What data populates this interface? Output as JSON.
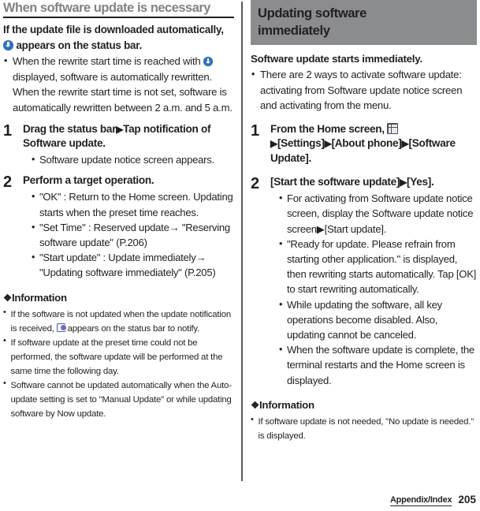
{
  "page": {
    "number": "205",
    "footer_tab": "Appendix/Index"
  },
  "left": {
    "header": "When software update is necessary",
    "lead_a": "If the update file is downloaded automatically, ",
    "lead_b": " appears on the status bar.",
    "lead_bullets": [
      "When the rewrite start time is reached with",
      " displayed, software is automatically rewritten. When the rewrite start time is not set, software is automatically rewritten between 2 a.m. and 5 a.m."
    ],
    "steps": [
      {
        "num": "1",
        "title_a": "Drag the status bar",
        "title_arrow": "▶",
        "title_b": "Tap notification of Software update.",
        "bullets": [
          "Software update notice screen appears."
        ]
      },
      {
        "num": "2",
        "title_a": "Perform a target operation.",
        "title_arrow": "",
        "title_b": "",
        "bullets": [
          "\"OK\" : Return to the Home screen. Updating starts when the preset time reaches.",
          "\"Set Time\" : Reserved update→ \"Reserving software update\" (P.206)",
          "\"Start update\" : Update immediately→ \"Updating software immediately\" (P.205)"
        ]
      }
    ],
    "info": {
      "heading": "Information",
      "bullets_pre": "If the software is not updated when the update notification is received, ",
      "bullets_post": " appears on the status bar to notify.",
      "bullets": [
        "If software update at the preset time could not be performed, the software update will be performed at the same time the following day.",
        "Software cannot be updated automatically when the Auto-update setting is set to \"Manual Update\" or while updating software by Now update."
      ]
    }
  },
  "right": {
    "header_line1": "Updating software",
    "header_line2": "immediately",
    "lead": "Software update starts immediately.",
    "lead_bullets": [
      "There are 2 ways to activate software update: activating from Software update notice screen and activating from the menu."
    ],
    "steps": [
      {
        "num": "1",
        "title_a": "From the Home screen, ",
        "title_b": "[Settings]",
        "title_c": "[About phone]",
        "title_d": "[Software Update].",
        "bullets": []
      },
      {
        "num": "2",
        "title_a": "[Start the software update]",
        "title_b": "[Yes].",
        "bullets": [
          "For activating from Software update notice screen, display the Software update notice screen▶[Start update].",
          "\"Ready for update. Please refrain from starting other application.\" is displayed, then rewriting starts automatically. Tap [OK] to start rewriting automatically.",
          "While updating the software, all key operations become disabled. Also, updating cannot be canceled.",
          "When the software update is complete, the terminal restarts and the Home screen is displayed."
        ]
      }
    ],
    "info": {
      "heading": "Information",
      "bullets": [
        "If software update is not needed, \"No update is needed.\" is displayed."
      ]
    }
  },
  "icons": {
    "download": "download-circle-icon",
    "notification": "notification-icon",
    "app_drawer": "app-drawer-grid-icon"
  },
  "colors": {
    "header_box_bg": "#8a8c8e",
    "header_text_gray": "#808285",
    "body_text": "#231f20",
    "icon_blue": "#2f6fbe"
  }
}
